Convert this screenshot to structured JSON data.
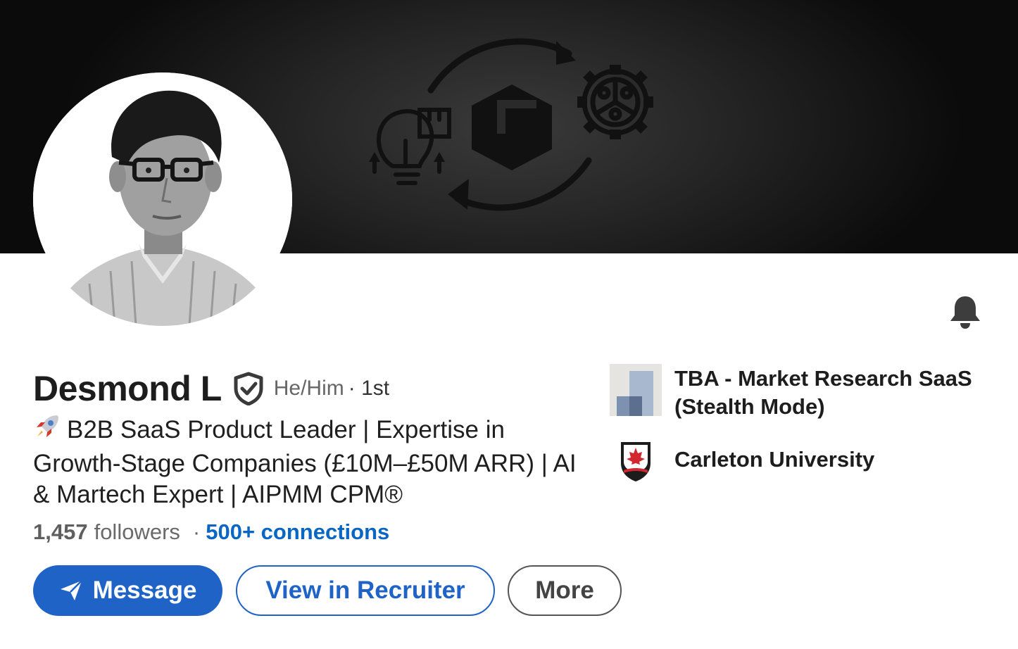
{
  "profile": {
    "name": "Desmond L",
    "pronouns": "He/Him",
    "degree": "· 1st",
    "headline": "B2B SaaS Product Leader | Expertise in Growth-Stage Companies (£10M–£50M ARR) | AI & Martech Expert | AIPMM CPM®",
    "headline_emoji": "🚀"
  },
  "stats": {
    "followers_count": "1,457",
    "followers_label": "followers",
    "separator": "·",
    "connections": "500+ connections"
  },
  "actions": {
    "message": "Message",
    "recruiter": "View in Recruiter",
    "more": "More"
  },
  "experience": {
    "company": "TBA - Market Research SaaS (Stealth Mode)",
    "school": "Carleton University"
  },
  "colors": {
    "primary": "#1f63c6",
    "link": "#0a66c2",
    "banner": "#1a1a1a"
  },
  "icons": {
    "verified": "shield-check-icon",
    "bell": "bell-icon",
    "send": "paper-plane-icon"
  }
}
